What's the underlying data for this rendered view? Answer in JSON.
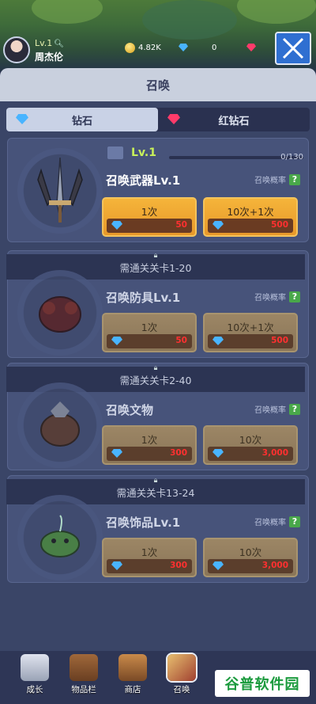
{
  "hud": {
    "level": "Lv.1",
    "player_name": "周杰伦",
    "coins": "4.82K",
    "diamonds": "0"
  },
  "panel": {
    "title": "召唤",
    "tabs": [
      {
        "label": "钻石",
        "active": true,
        "icon": "blue-diamond-icon"
      },
      {
        "label": "红钻石",
        "active": false,
        "icon": "red-diamond-icon"
      }
    ]
  },
  "cards": [
    {
      "level": "Lv.1",
      "progress": "0/130",
      "progress_fraction": 0,
      "title": "召唤武器Lv.1",
      "rate_label": "召唤概率",
      "rate_icon": "?",
      "buttons": [
        {
          "label": "1次",
          "cost": "50"
        },
        {
          "label": "10次+1次",
          "cost": "500"
        }
      ]
    },
    {
      "lock_text": "需通关关卡1-20",
      "title": "召唤防具Lv.1",
      "rate_label": "召唤概率",
      "rate_icon": "?",
      "buttons": [
        {
          "label": "1次",
          "cost": "50"
        },
        {
          "label": "10次+1次",
          "cost": "500"
        }
      ]
    },
    {
      "lock_text": "需通关关卡2-40",
      "title": "召唤文物",
      "rate_label": "召唤概率",
      "rate_icon": "?",
      "buttons": [
        {
          "label": "1次",
          "cost": "300"
        },
        {
          "label": "10次",
          "cost": "3,000"
        }
      ]
    },
    {
      "lock_text": "需通关关卡13-24",
      "title": "召唤饰品Lv.1",
      "rate_label": "召唤概率",
      "rate_icon": "?",
      "buttons": [
        {
          "label": "1次",
          "cost": "300"
        },
        {
          "label": "10次",
          "cost": "3,000"
        }
      ]
    }
  ],
  "navbar": {
    "items": [
      {
        "label": "成长"
      },
      {
        "label": "物品栏"
      },
      {
        "label": "商店"
      },
      {
        "label": "召唤"
      }
    ]
  },
  "watermark": "谷普软件园",
  "colors": {
    "accent_button": "#f5b43a",
    "level_green": "#c8f05a",
    "cost_red": "#ff3030",
    "panel": "#3a4567"
  }
}
